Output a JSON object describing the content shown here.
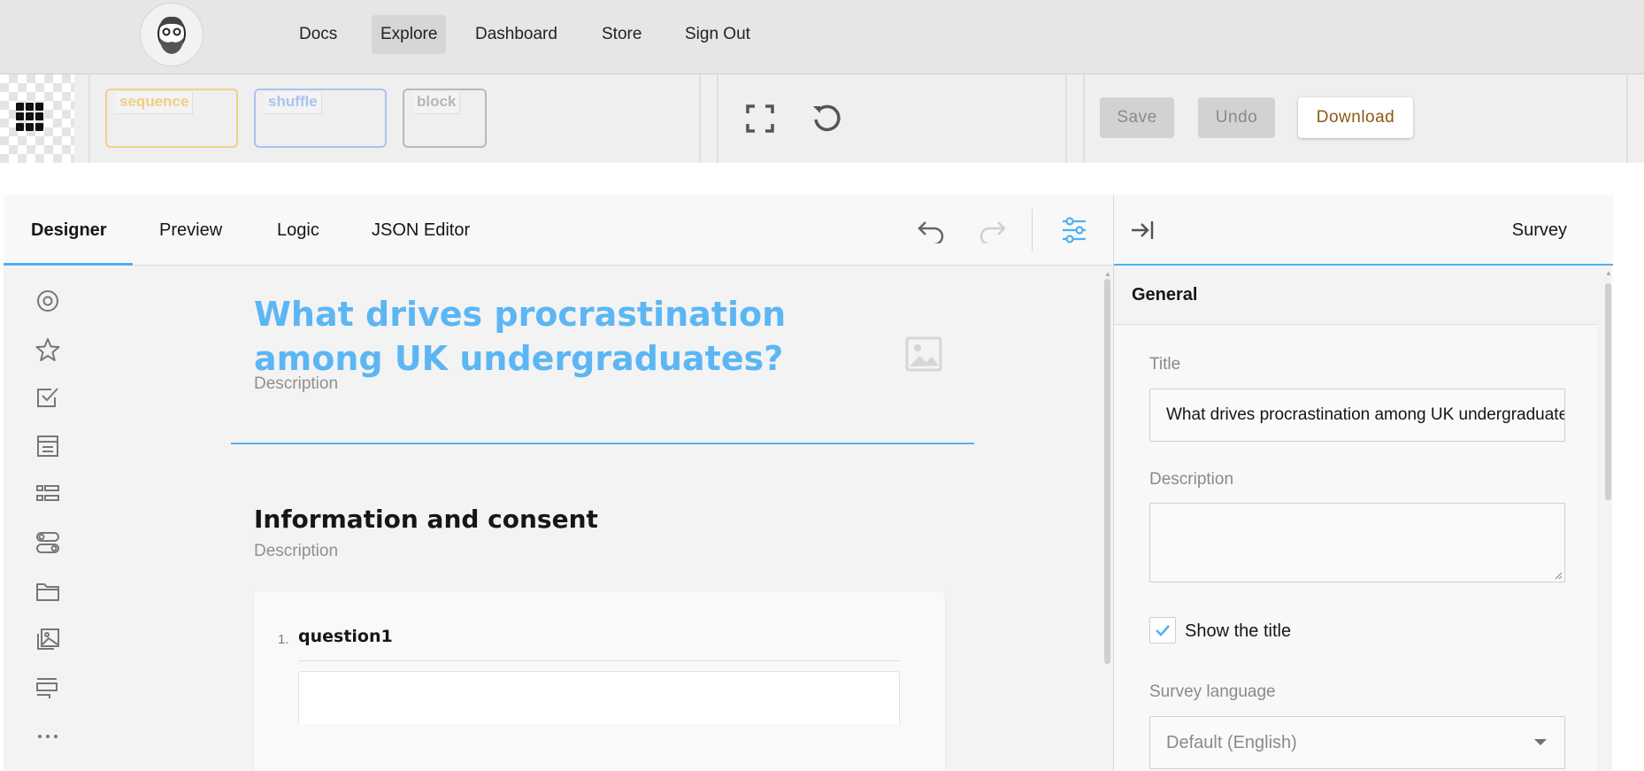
{
  "nav": {
    "items": [
      "Docs",
      "Explore",
      "Dashboard",
      "Store",
      "Sign Out"
    ],
    "active": "Explore"
  },
  "toolbar": {
    "chips": [
      "sequence",
      "shuffle",
      "block"
    ],
    "save_label": "Save",
    "undo_label": "Undo",
    "download_label": "Download"
  },
  "creator": {
    "tabs": [
      "Designer",
      "Preview",
      "Logic",
      "JSON Editor"
    ],
    "active_tab": "Designer"
  },
  "survey": {
    "title": "What drives procrastination among UK undergraduates?",
    "description_placeholder": "Description",
    "page": {
      "title": "Information and consent",
      "description_placeholder": "Description"
    },
    "question": {
      "number": "1.",
      "title": "question1"
    }
  },
  "toolbox": {
    "icons": [
      "radiogroup-icon",
      "rating-icon",
      "checkbox-icon",
      "dropdown-icon",
      "ranking-icon",
      "boolean-icon",
      "file-icon",
      "imagepicker-icon",
      "panel-icon",
      "more-icon"
    ]
  },
  "properties": {
    "object_name": "Survey",
    "category": "General",
    "title_label": "Title",
    "title_value": "What drives procrastination among UK undergraduates?",
    "description_label": "Description",
    "show_title_label": "Show the title",
    "show_title_checked": true,
    "language_label": "Survey language",
    "language_value": "Default (English)"
  },
  "colors": {
    "accent": "#4fb0f2",
    "title": "#5cb6f4",
    "download_text": "#8b5a10",
    "sequence": "#f0d08a",
    "shuffle": "#a8c4f3",
    "block": "#b9b9b9"
  }
}
